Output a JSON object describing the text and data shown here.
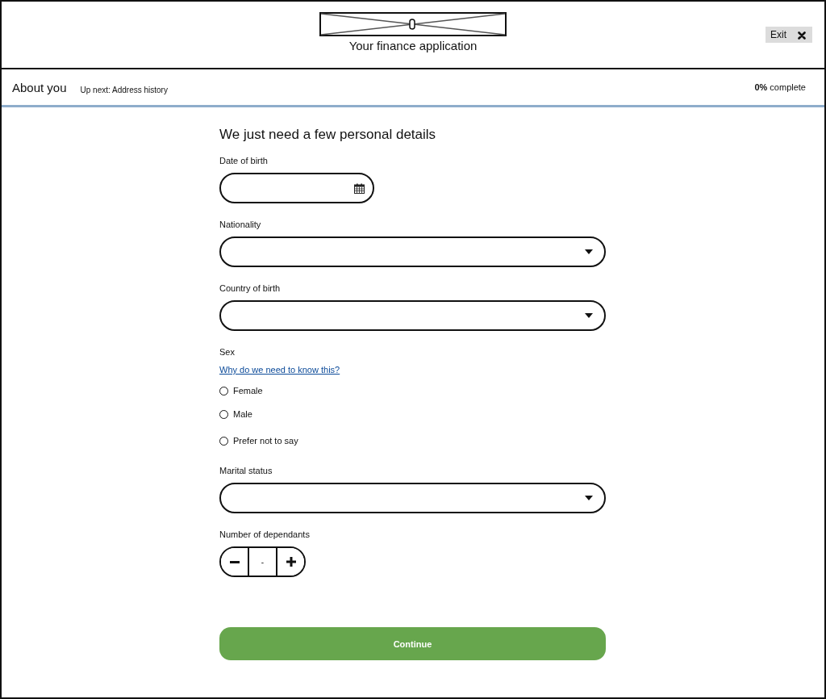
{
  "header": {
    "title": "Your finance application",
    "exit_button": "Exit"
  },
  "progress_bar": {
    "section": "About you",
    "up_next": "Up next: Address history",
    "completion": "**0%** complete"
  },
  "form": {
    "heading": "We just need a few personal details",
    "fields": [
      {
        "kind": "date",
        "label": "Date of birth"
      },
      {
        "kind": "select",
        "label": "Nationality"
      },
      {
        "kind": "select",
        "label": "Country of birth"
      },
      {
        "kind": "radio",
        "label": "Sex",
        "help_link": "Why do we need to know this?",
        "options": [
          {
            "label": "Female",
            "selected": false
          },
          {
            "label": "Male",
            "selected": false
          },
          {
            "label": "Prefer not to say",
            "selected": false
          }
        ]
      },
      {
        "kind": "select",
        "label": "Marital status"
      },
      {
        "kind": "stepper",
        "label": "Number of dependants",
        "value": "-"
      }
    ],
    "continue_button": "Continue"
  }
}
